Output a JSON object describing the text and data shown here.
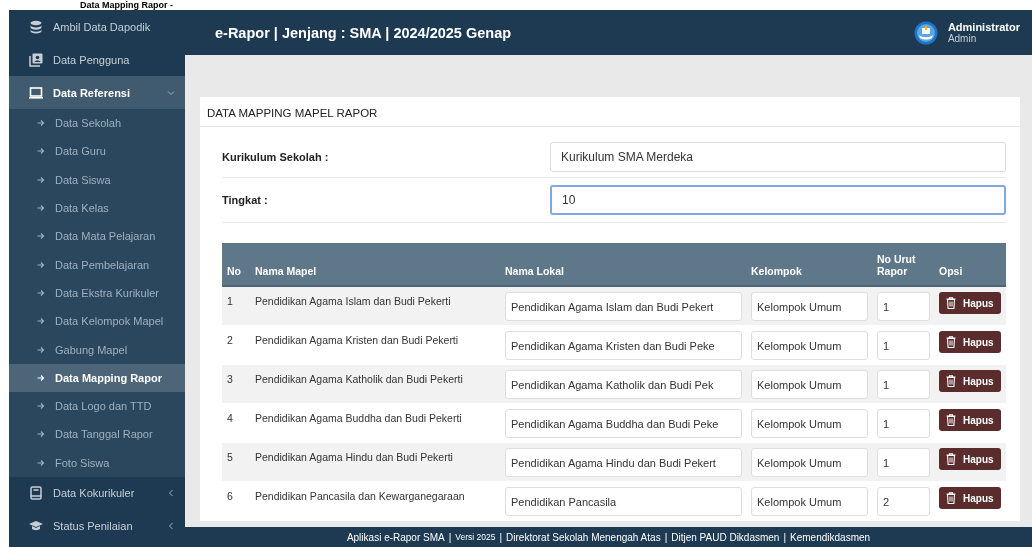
{
  "caption": "Data Mapping Rapor -",
  "sidebar": {
    "items": [
      {
        "label": "Ambil Data Dapodik",
        "selected": false
      },
      {
        "label": "Data Pengguna",
        "selected": false
      },
      {
        "label": "Data Referensi",
        "selected": true,
        "expanded": true,
        "children": [
          {
            "label": "Data Sekolah",
            "selected": false
          },
          {
            "label": "Data Guru",
            "selected": false
          },
          {
            "label": "Data Siswa",
            "selected": false
          },
          {
            "label": "Data Kelas",
            "selected": false
          },
          {
            "label": "Data Mata Pelajaran",
            "selected": false
          },
          {
            "label": "Data Pembelajaran",
            "selected": false
          },
          {
            "label": "Data Ekstra Kurikuler",
            "selected": false
          },
          {
            "label": "Data Kelompok Mapel",
            "selected": false
          },
          {
            "label": "Gabung Mapel",
            "selected": false
          },
          {
            "label": "Data Mapping Rapor",
            "selected": true
          },
          {
            "label": "Data Logo dan TTD",
            "selected": false
          },
          {
            "label": "Data Tanggal Rapor",
            "selected": false
          },
          {
            "label": "Foto Siswa",
            "selected": false
          }
        ]
      },
      {
        "label": "Data Kokurikuler",
        "selected": false,
        "expanded": false
      },
      {
        "label": "Status Penilaian",
        "selected": false,
        "expanded": false
      }
    ]
  },
  "header": {
    "title": "e-Rapor | Jenjang : SMA | 2024/2025 Genap",
    "user_name": "Administrator",
    "user_role": "Admin"
  },
  "card": {
    "title": "DATA MAPPING MAPEL RAPOR",
    "fields": [
      {
        "label": "Kurikulum Sekolah :",
        "value": "Kurikulum SMA Merdeka",
        "focused": false
      },
      {
        "label": "Tingkat :",
        "value": "10",
        "focused": true
      }
    ]
  },
  "table": {
    "columns": [
      "No",
      "Nama Mapel",
      "Nama Lokal",
      "Kelompok",
      "No Urut Rapor",
      "Opsi"
    ],
    "rows": [
      {
        "no": "1",
        "nama_mapel": "Pendidikan Agama Islam dan Budi Pekerti",
        "nama_lokal": "Pendidikan Agama Islam dan Budi Pekert",
        "kelompok": "Kelompok Umum",
        "no_urut": "1",
        "action": "Hapus"
      },
      {
        "no": "2",
        "nama_mapel": "Pendidikan Agama Kristen dan Budi Pekerti",
        "nama_lokal": "Pendidikan Agama Kristen dan Budi Peke",
        "kelompok": "Kelompok Umum",
        "no_urut": "1",
        "action": "Hapus"
      },
      {
        "no": "3",
        "nama_mapel": "Pendidikan Agama Katholik dan Budi Pekerti",
        "nama_lokal": "Pendidikan Agama Katholik dan Budi Pek",
        "kelompok": "Kelompok Umum",
        "no_urut": "1",
        "action": "Hapus"
      },
      {
        "no": "4",
        "nama_mapel": "Pendidikan Agama Buddha dan Budi Pekerti",
        "nama_lokal": "Pendidikan Agama Buddha dan Budi Peke",
        "kelompok": "Kelompok Umum",
        "no_urut": "1",
        "action": "Hapus"
      },
      {
        "no": "5",
        "nama_mapel": "Pendidikan Agama Hindu dan Budi Pekerti",
        "nama_lokal": "Pendidikan Agama Hindu dan Budi Pekert",
        "kelompok": "Kelompok Umum",
        "no_urut": "1",
        "action": "Hapus"
      },
      {
        "no": "6",
        "nama_mapel": "Pendidikan Pancasila dan Kewarganegaraan",
        "nama_lokal": "Pendidikan Pancasila",
        "kelompok": "Kelompok Umum",
        "no_urut": "2",
        "action": "Hapus"
      }
    ]
  },
  "footer": {
    "parts": [
      {
        "text": "Aplikasi e-Rapor SMA",
        "small": false
      },
      {
        "text": "Versi 2025",
        "small": true
      },
      {
        "text": "Direktorat Sekolah Menengah Atas",
        "small": false
      },
      {
        "text": "Ditjen PAUD Dikdasmen",
        "small": false
      },
      {
        "text": "Kemendikdasmen",
        "small": false
      }
    ],
    "separator": "|"
  }
}
